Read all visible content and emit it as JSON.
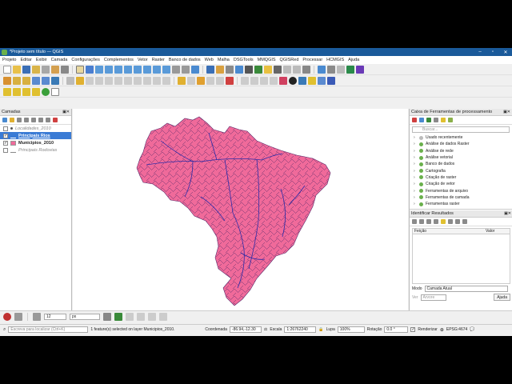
{
  "window": {
    "title": "*Projeto sem título — QGIS",
    "minimize": "–",
    "maximize": "▫",
    "close": "✕"
  },
  "menu": [
    "Projeto",
    "Editar",
    "Exibir",
    "Camada",
    "Configurações",
    "Complementos",
    "Vetor",
    "Raster",
    "Banco de dados",
    "Web",
    "Malha",
    "DSGTools",
    "MMQGIS",
    "QGISRed",
    "Processar",
    "HCMGIS",
    "Ajuda"
  ],
  "layers_panel": {
    "title": "Camadas",
    "layers": [
      {
        "name": "Localidades_2010",
        "checked": false,
        "selected": false,
        "style": "italic-gray"
      },
      {
        "name": "Principais Rios",
        "checked": true,
        "selected": true
      },
      {
        "name": "Municipios_2010",
        "checked": true,
        "selected": false
      },
      {
        "name": "Principais Rodovias",
        "checked": false,
        "selected": false,
        "style": "italic-gray"
      }
    ]
  },
  "toolbox": {
    "title": "Caixa de Ferramentas de processamento",
    "search_placeholder": "Buscar...",
    "items": [
      "Usado recentemente",
      "Análise de dados Raster",
      "Análise de rede",
      "Análise vetorial",
      "Banco de dados",
      "Cartografia",
      "Criação de raster",
      "Criação de vetor",
      "Ferramentas de arquivo",
      "Ferramentas de camada",
      "Ferramentas raster"
    ]
  },
  "identify": {
    "title": "Identificar Resultados",
    "col_feature": "Feição",
    "col_value": "Valor",
    "mode_label": "Modo",
    "mode_value": "Camada Atual",
    "view_label": "Ver",
    "view_value": "Árvore",
    "help_button": "Ajuda"
  },
  "bottom_toolbar": {
    "size_value": "12",
    "unit_value": "px"
  },
  "status": {
    "locate_placeholder": "Escreva para localizar (Ctrl+K)",
    "message": "1 feature(s) selected on layer Municipios_2010.",
    "coord_label": "Coordenada",
    "coord_value": "-86.94,-12.30",
    "scale_label": "Escala",
    "scale_value": "1:26762240",
    "magnifier_label": "Lupa",
    "magnifier_value": "100%",
    "rotation_label": "Rotação",
    "rotation_value": "0.0 °",
    "render_label": "Renderizar",
    "crs": "EPSG:4674"
  },
  "colors": {
    "fill": "#f06a9a",
    "rivers": "#2a2aa8",
    "accent": "#3a7bd5"
  }
}
